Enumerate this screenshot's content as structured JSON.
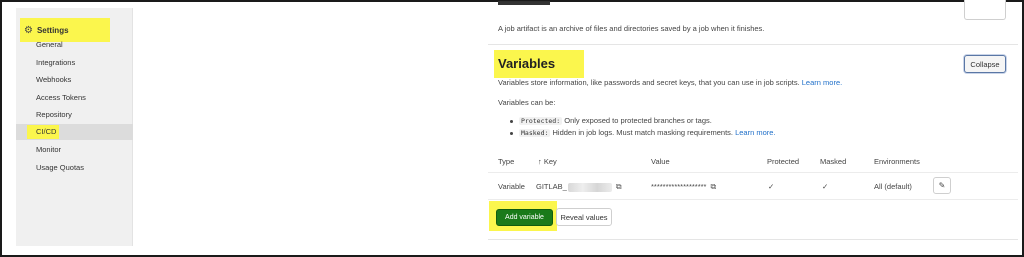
{
  "sidebar": {
    "header": "Settings",
    "items": [
      {
        "label": "General"
      },
      {
        "label": "Integrations"
      },
      {
        "label": "Webhooks"
      },
      {
        "label": "Access Tokens"
      },
      {
        "label": "Repository"
      },
      {
        "label": "CI/CD"
      },
      {
        "label": "Monitor"
      },
      {
        "label": "Usage Quotas"
      }
    ]
  },
  "artifacts": {
    "description": "A job artifact is an archive of files and directories saved by a job when it finishes."
  },
  "variables": {
    "title": "Variables",
    "collapse_label": "Collapse",
    "description": "Variables store information, like passwords and secret keys, that you can use in job scripts.",
    "learn_more": "Learn more.",
    "can_be": "Variables can be:",
    "bullets": [
      {
        "code": "Protected:",
        "text": "Only exposed to protected branches or tags.",
        "link": ""
      },
      {
        "code": "Masked:",
        "text": "Hidden in job logs. Must match masking requirements.",
        "link": "Learn more."
      }
    ],
    "table": {
      "headers": {
        "type": "Type",
        "key": "↑ Key",
        "value": "Value",
        "protected": "Protected",
        "masked": "Masked",
        "environments": "Environments"
      },
      "rows": [
        {
          "type": "Variable",
          "key": "GITLAB_",
          "value": "*******************",
          "protected": "✓",
          "masked": "✓",
          "environments": "All (default)"
        }
      ]
    },
    "add_label": "Add variable",
    "reveal_label": "Reveal values"
  },
  "colors": {
    "highlight": "#fbf64d",
    "primary_button": "#1a7a1a",
    "link": "#1f6fc9"
  }
}
